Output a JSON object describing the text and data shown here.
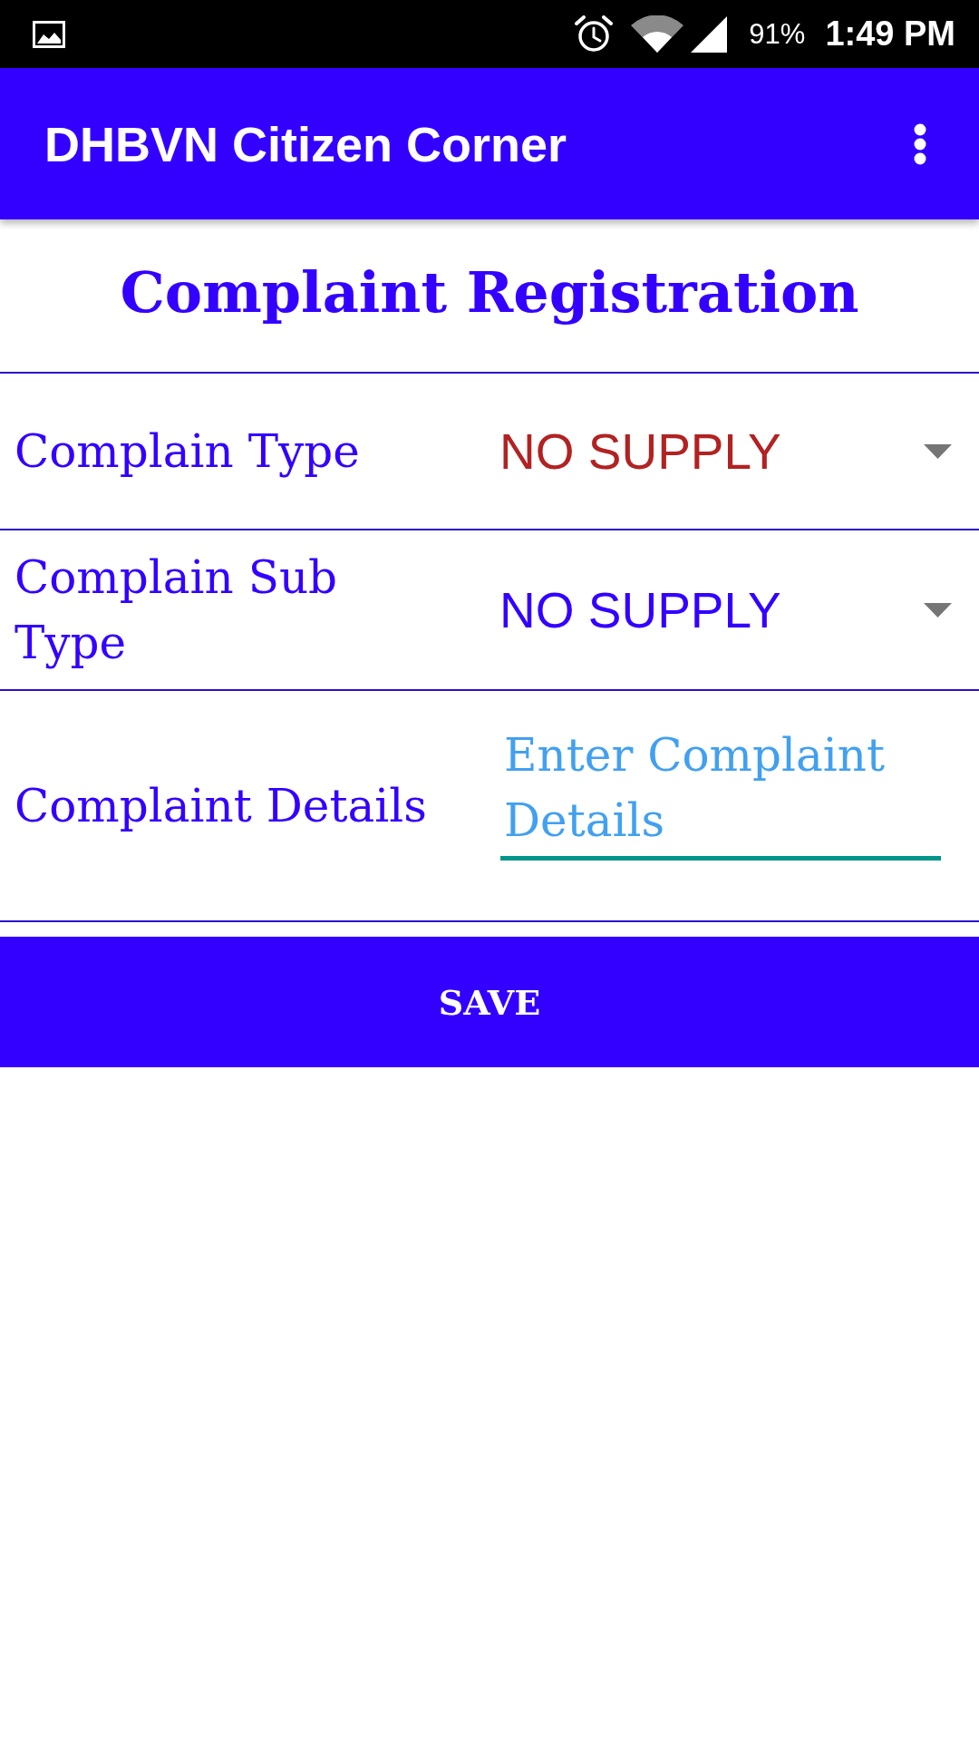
{
  "status_bar": {
    "battery": "91%",
    "time": "1:49 PM"
  },
  "app_bar": {
    "title": "DHBVN Citizen Corner"
  },
  "heading": "Complaint Registration",
  "fields": [
    {
      "kind": "dropdown",
      "label": "Complain Type",
      "value": "NO SUPPLY",
      "color": "#b22222"
    },
    {
      "kind": "dropdown",
      "label": "Complain Sub Type",
      "value": "NO SUPPLY",
      "color": "#3300ff"
    },
    {
      "kind": "text",
      "label": "Complaint Details",
      "placeholder": "Enter Complaint Details"
    }
  ],
  "save_button": "SAVE"
}
